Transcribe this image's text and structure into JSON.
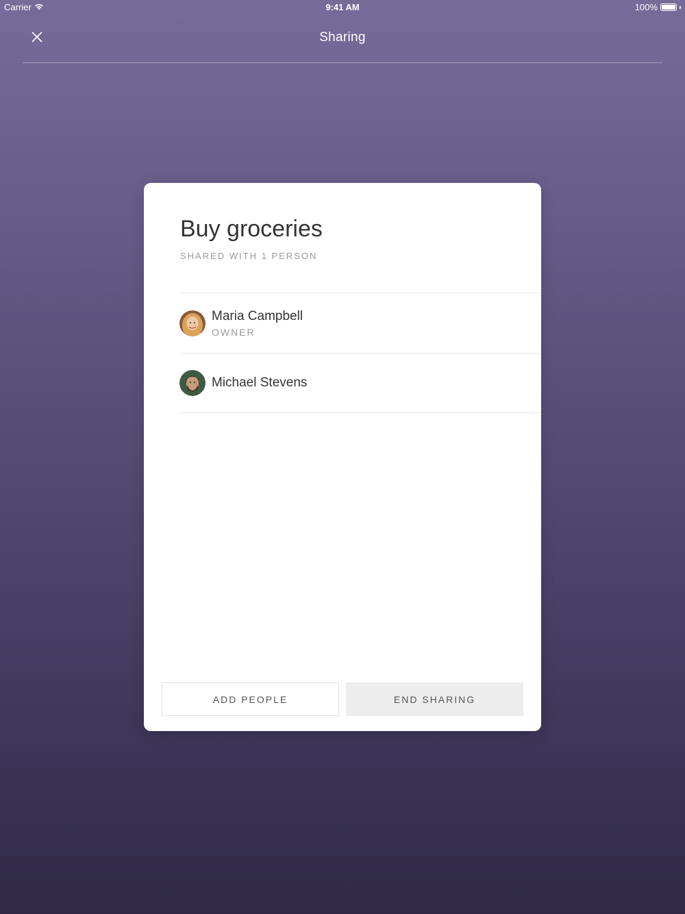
{
  "status_bar": {
    "carrier": "Carrier",
    "time": "9:41 AM",
    "battery": "100%",
    "battery_level": 1.0
  },
  "nav": {
    "title": "Sharing",
    "close_icon": "close-icon"
  },
  "card": {
    "title": "Buy groceries",
    "subtitle": "SHARED WITH 1 PERSON",
    "people": [
      {
        "name": "Maria Campbell",
        "role": "OWNER",
        "avatar": "avatar-maria"
      },
      {
        "name": "Michael Stevens",
        "role": "",
        "avatar": "avatar-michael"
      }
    ],
    "buttons": {
      "add_label": "ADD PEOPLE",
      "end_label": "END SHARING"
    }
  },
  "colors": {
    "background_top": "#766c9a",
    "background_bottom": "#2f2947",
    "card": "#ffffff",
    "end_button_bg": "#ededed"
  }
}
